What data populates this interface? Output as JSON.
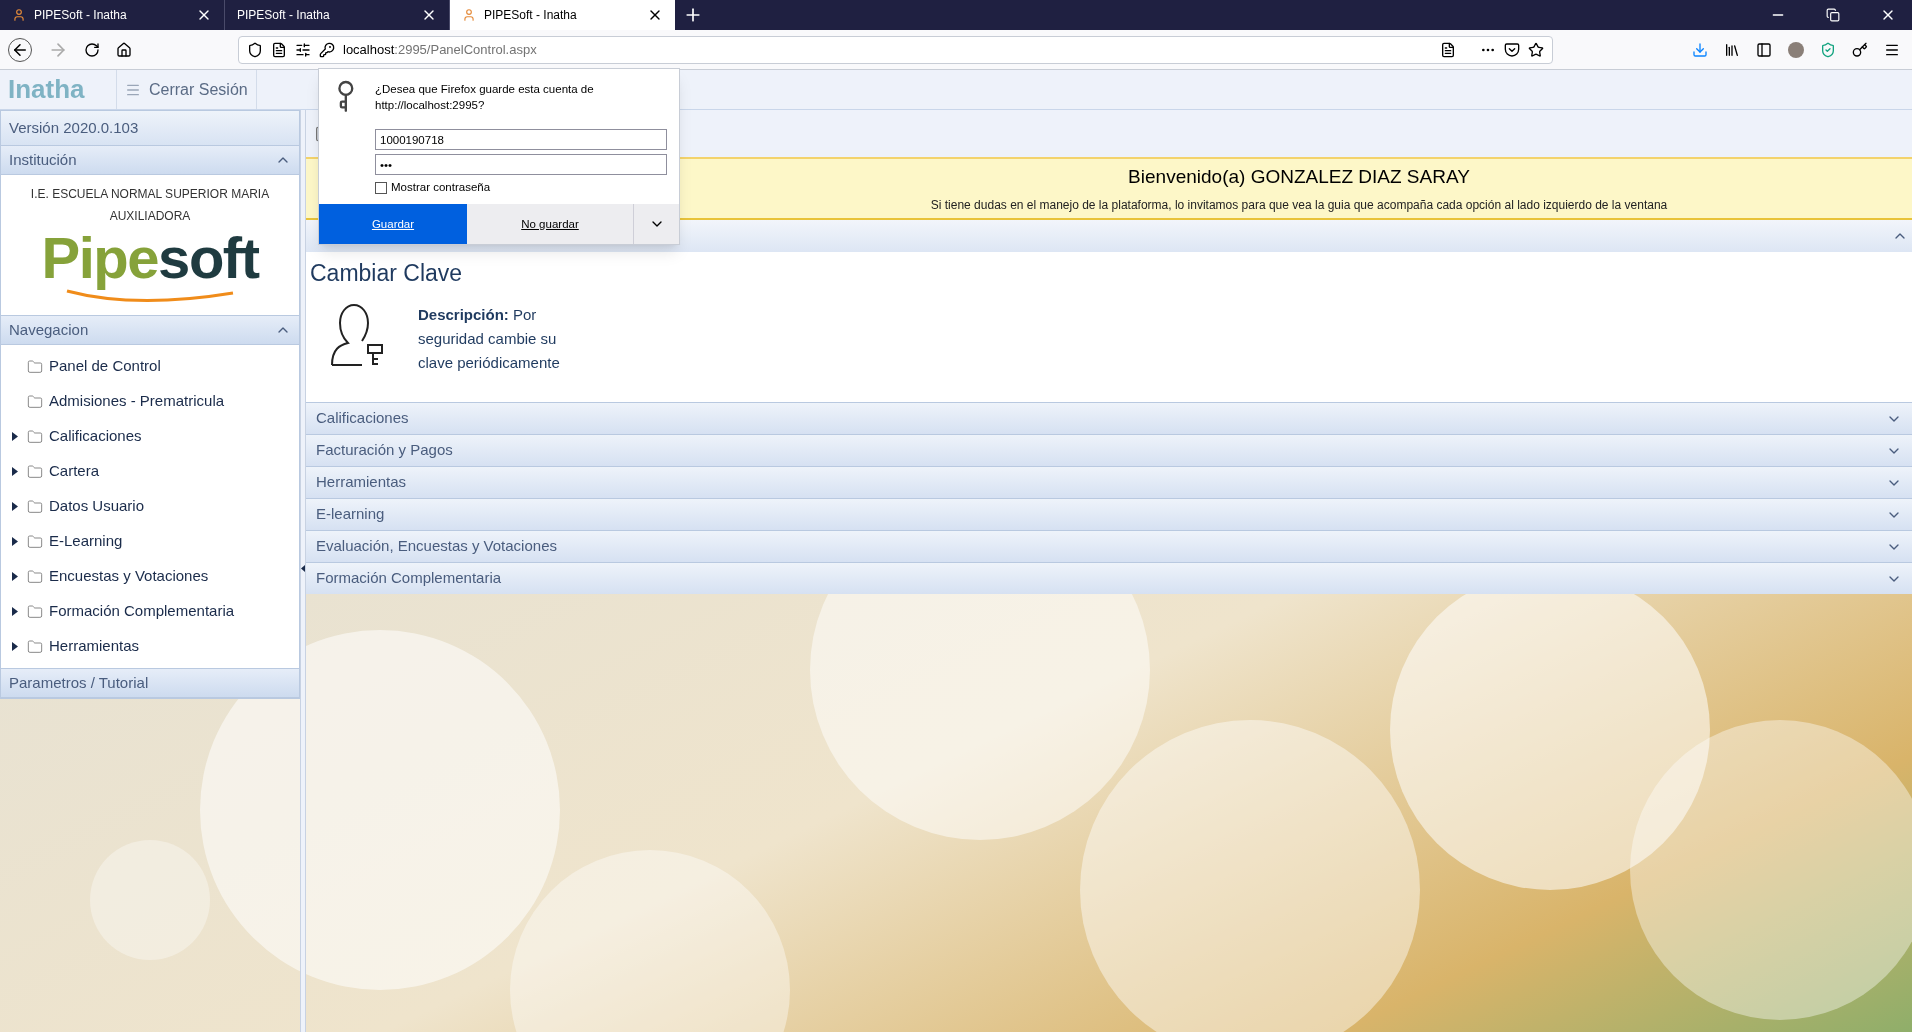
{
  "browser": {
    "tabs": [
      {
        "title": "PIPESoft - Inatha",
        "selected": false,
        "has_icon": true
      },
      {
        "title": "PIPESoft - Inatha",
        "selected": false,
        "has_icon": false
      },
      {
        "title": "PIPESoft - Inatha",
        "selected": true,
        "has_icon": true
      }
    ],
    "url_host": "localhost",
    "url_path": ":2995/PanelControl.aspx"
  },
  "password_prompt": {
    "question": "¿Desea que Firefox guarde esta cuenta de http://localhost:2995?",
    "username": "1000190718",
    "password_mask": "•••",
    "show_password": {
      "label": "Mostrar contraseña",
      "checked": false
    },
    "save_button": "Guardar",
    "dont_save_button": "No guardar"
  },
  "header": {
    "logo": "Inatha",
    "logout": "Cerrar Sesión"
  },
  "sidebar": {
    "version": "Versión 2020.0.103",
    "institution": {
      "title": "Institución",
      "expanded": true,
      "name": "I.E. ESCUELA NORMAL SUPERIOR MARIA AUXILIADORA",
      "logo_part_1": "Pipe",
      "logo_part_2": "soft"
    },
    "navigation": {
      "title": "Navegacion",
      "expanded": true,
      "items": [
        {
          "label": "Panel de Control",
          "kind": "leaf"
        },
        {
          "label": "Admisiones - Prematricula",
          "kind": "leaf"
        },
        {
          "label": "Calificaciones",
          "kind": "folder"
        },
        {
          "label": "Cartera",
          "kind": "folder"
        },
        {
          "label": "Datos Usuario",
          "kind": "folder"
        },
        {
          "label": "E-Learning",
          "kind": "folder"
        },
        {
          "label": "Encuestas y Votaciones",
          "kind": "folder"
        },
        {
          "label": "Formación Complementaria",
          "kind": "folder"
        },
        {
          "label": "Herramientas",
          "kind": "folder"
        }
      ]
    },
    "footer_section": {
      "title": "Parametros / Tutorial",
      "expanded": false
    }
  },
  "main": {
    "welcome": {
      "title": "Bienvenido(a) GONZALEZ DIAZ SARAY",
      "subtitle": "Si tiene dudas en el manejo de la plataforma, lo invitamos para que vea la guia que acompaña cada opción al lado izquierdo de la ventana"
    },
    "panel": {
      "expanded": true,
      "title": "Cambiar Clave",
      "description": "**Descripción:** Por seguridad cambie su clave periódicamente"
    },
    "sections": [
      {
        "label": "Calificaciones",
        "expanded": false
      },
      {
        "label": "Facturación y Pagos",
        "expanded": false
      },
      {
        "label": "Herramientas",
        "expanded": false
      },
      {
        "label": "E-learning",
        "expanded": false
      },
      {
        "label": "Evaluación, Encuestas y Votaciones",
        "expanded": false
      },
      {
        "label": "Formación Complementaria",
        "expanded": false
      }
    ]
  }
}
